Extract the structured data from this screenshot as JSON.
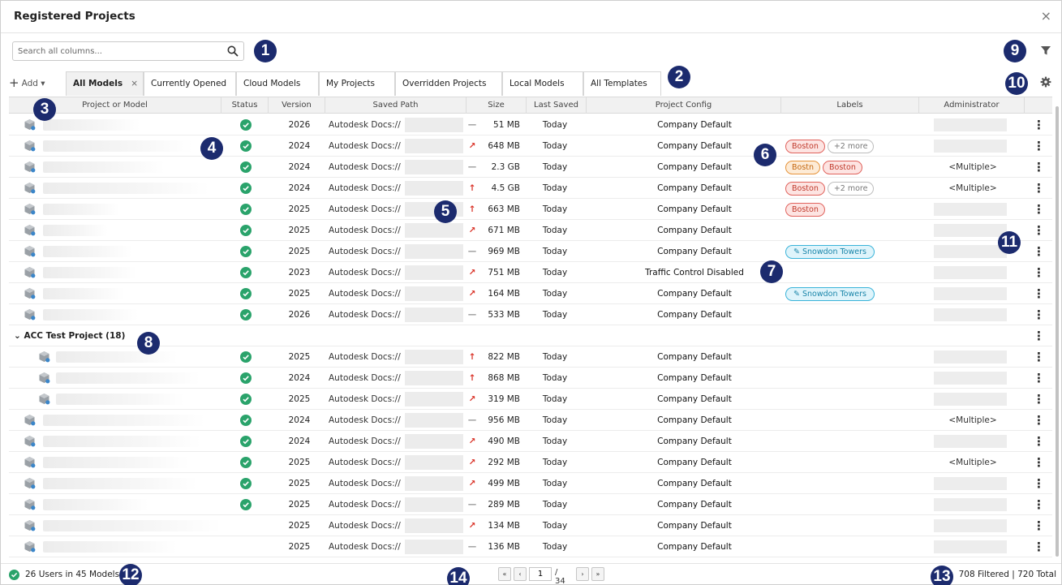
{
  "window": {
    "title": "Registered Projects",
    "close": "×"
  },
  "search": {
    "placeholder": "Search all columns..."
  },
  "add": {
    "label": "Add ▾"
  },
  "tabs": [
    {
      "label": "All Models",
      "active": true
    },
    {
      "label": "Currently Opened"
    },
    {
      "label": "Cloud Models"
    },
    {
      "label": "My Projects"
    },
    {
      "label": "Overridden Projects"
    },
    {
      "label": "Local Models"
    },
    {
      "label": "All Templates"
    }
  ],
  "columns": [
    "Project or Model",
    "Status",
    "Version",
    "Saved Path",
    "Size",
    "Last Saved",
    "Project Config",
    "Labels",
    "Administrator"
  ],
  "rows": [
    {
      "version": "2026",
      "path": "Autodesk Docs://",
      "trend": "—",
      "size": "51 MB",
      "saved": "Today",
      "config": "Company Default",
      "labels": [],
      "admin": ""
    },
    {
      "version": "2024",
      "path": "Autodesk Docs://",
      "trend": "↗",
      "size": "648 MB",
      "saved": "Today",
      "config": "Company Default",
      "labels": [
        {
          "text": "Boston",
          "style": "red"
        },
        {
          "text": "+2 more",
          "style": "more"
        }
      ],
      "admin": ""
    },
    {
      "version": "2024",
      "path": "Autodesk Docs://",
      "trend": "—",
      "size": "2.3 GB",
      "saved": "Today",
      "config": "Company Default",
      "labels": [
        {
          "text": "Bostn",
          "style": "orange"
        },
        {
          "text": "Boston",
          "style": "red"
        }
      ],
      "admin": "<Multiple>"
    },
    {
      "version": "2024",
      "path": "Autodesk Docs://",
      "trend": "↑",
      "size": "4.5 GB",
      "saved": "Today",
      "config": "Company Default",
      "labels": [
        {
          "text": "Boston",
          "style": "red"
        },
        {
          "text": "+2 more",
          "style": "more"
        }
      ],
      "admin": "<Multiple>"
    },
    {
      "version": "2025",
      "path": "Autodesk Docs://",
      "trend": "↑",
      "size": "663 MB",
      "saved": "Today",
      "config": "Company Default",
      "labels": [
        {
          "text": "Boston",
          "style": "red"
        }
      ],
      "admin": ""
    },
    {
      "version": "2025",
      "path": "Autodesk Docs://",
      "trend": "↗",
      "size": "671 MB",
      "saved": "Today",
      "config": "Company Default",
      "labels": [],
      "admin": ""
    },
    {
      "version": "2025",
      "path": "Autodesk Docs://",
      "trend": "—",
      "size": "969 MB",
      "saved": "Today",
      "config": "Company Default",
      "labels": [
        {
          "text": "✎ Snowdon Towers",
          "style": "teal"
        }
      ],
      "admin": ""
    },
    {
      "version": "2023",
      "path": "Autodesk Docs://",
      "trend": "↗",
      "size": "751 MB",
      "saved": "Today",
      "config": "Traffic Control Disabled",
      "labels": [],
      "admin": ""
    },
    {
      "version": "2025",
      "path": "Autodesk Docs://",
      "trend": "↗",
      "size": "164 MB",
      "saved": "Today",
      "config": "Company Default",
      "labels": [
        {
          "text": "✎ Snowdon Towers",
          "style": "teal"
        }
      ],
      "admin": ""
    },
    {
      "version": "2026",
      "path": "Autodesk Docs://",
      "trend": "—",
      "size": "533 MB",
      "saved": "Today",
      "config": "Company Default",
      "labels": [],
      "admin": ""
    }
  ],
  "group": {
    "label": "⌄ ACC Test Project (18)"
  },
  "group_rows": [
    {
      "version": "2025",
      "path": "Autodesk Docs://",
      "trend": "↑",
      "size": "822 MB",
      "saved": "Today",
      "config": "Company Default",
      "labels": [],
      "admin": "",
      "status": true,
      "indent": true
    },
    {
      "version": "2024",
      "path": "Autodesk Docs://",
      "trend": "↑",
      "size": "868 MB",
      "saved": "Today",
      "config": "Company Default",
      "labels": [],
      "admin": "",
      "status": true,
      "indent": true
    },
    {
      "version": "2025",
      "path": "Autodesk Docs://",
      "trend": "↗",
      "size": "319 MB",
      "saved": "Today",
      "config": "Company Default",
      "labels": [],
      "admin": "",
      "status": true,
      "indent": true
    },
    {
      "version": "2024",
      "path": "Autodesk Docs://",
      "trend": "—",
      "size": "956 MB",
      "saved": "Today",
      "config": "Company Default",
      "labels": [],
      "admin": "<Multiple>",
      "status": true
    },
    {
      "version": "2024",
      "path": "Autodesk Docs://",
      "trend": "↗",
      "size": "490 MB",
      "saved": "Today",
      "config": "Company Default",
      "labels": [],
      "admin": "",
      "status": true
    },
    {
      "version": "2025",
      "path": "Autodesk Docs://",
      "trend": "↗",
      "size": "292 MB",
      "saved": "Today",
      "config": "Company Default",
      "labels": [],
      "admin": "<Multiple>",
      "status": true
    },
    {
      "version": "2025",
      "path": "Autodesk Docs://",
      "trend": "↗",
      "size": "499 MB",
      "saved": "Today",
      "config": "Company Default",
      "labels": [],
      "admin": "",
      "status": true
    },
    {
      "version": "2025",
      "path": "Autodesk Docs://",
      "trend": "—",
      "size": "289 MB",
      "saved": "Today",
      "config": "Company Default",
      "labels": [],
      "admin": "",
      "status": true
    },
    {
      "version": "2025",
      "path": "Autodesk Docs://",
      "trend": "↗",
      "size": "134 MB",
      "saved": "Today",
      "config": "Company Default",
      "labels": [],
      "admin": "",
      "status": false
    },
    {
      "version": "2025",
      "path": "Autodesk Docs://",
      "trend": "—",
      "size": "136 MB",
      "saved": "Today",
      "config": "Company Default",
      "labels": [],
      "admin": "",
      "status": false
    }
  ],
  "footer": {
    "users": "26 Users in 45 Models",
    "page": "1",
    "page_total": "/ 34",
    "first": "«",
    "prev": "‹",
    "next": "›",
    "last": "»",
    "counts": "708 Filtered | 720 Total"
  },
  "callouts": [
    "1",
    "2",
    "3",
    "4",
    "5",
    "6",
    "7",
    "8",
    "9",
    "10",
    "11",
    "12",
    "13",
    "14"
  ],
  "icons": {
    "search": "search-icon",
    "filter": "filter-icon",
    "settings": "gear-icon",
    "status": "check-circle-icon",
    "project": "model-icon",
    "more": "kebab-icon"
  },
  "colors": {
    "status_ok": "#2aa36b",
    "callout": "#1c2b6e",
    "trend_up": "#d93025",
    "label_red": "#e0625c",
    "label_teal": "#39b3d9",
    "label_orange": "#e6933a"
  }
}
